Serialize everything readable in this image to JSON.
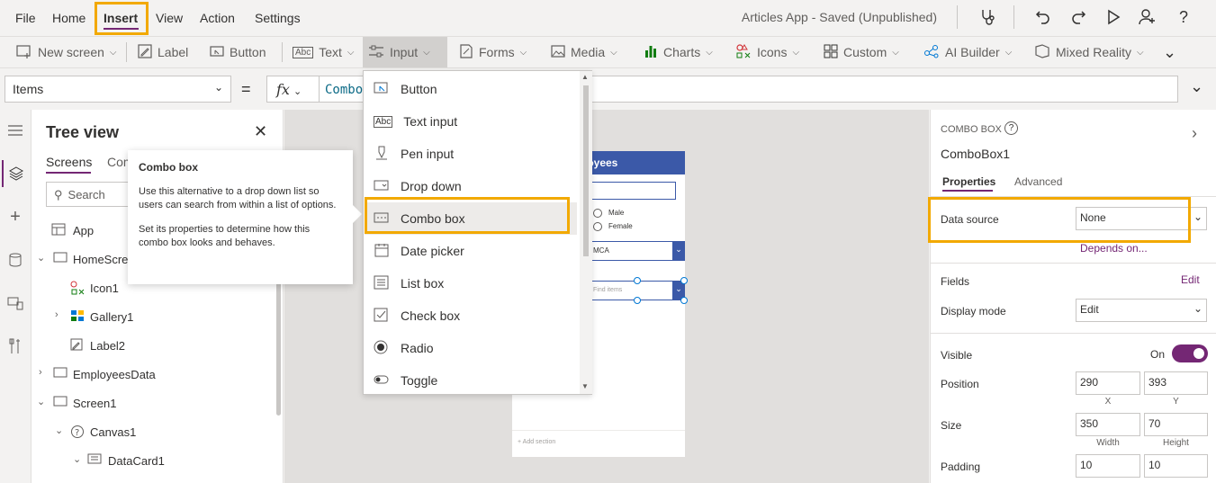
{
  "menubar": {
    "items": [
      "File",
      "Home",
      "Insert",
      "View",
      "Action",
      "Settings"
    ],
    "app_title": "Articles App - Saved (Unpublished)"
  },
  "ribbon": {
    "items": [
      "New screen",
      "Label",
      "Button",
      "Text",
      "Input",
      "Forms",
      "Media",
      "Charts",
      "Icons",
      "Custom",
      "AI Builder",
      "Mixed Reality"
    ]
  },
  "formula": {
    "property": "Items",
    "equals": "=",
    "fx": "fx",
    "value": "Combo"
  },
  "tree": {
    "title": "Tree view",
    "tab_screens": "Screens",
    "tab_components": "Com",
    "search_placeholder": "Search",
    "rows": [
      {
        "label": "App",
        "icon": "app-icon"
      },
      {
        "label": "HomeScree",
        "icon": "screen-icon"
      },
      {
        "label": "Icon1",
        "icon": "icon-icon"
      },
      {
        "label": "Gallery1",
        "icon": "gallery-icon"
      },
      {
        "label": "Label2",
        "icon": "label-icon"
      },
      {
        "label": "EmployeesData",
        "icon": "screen-icon"
      },
      {
        "label": "Screen1",
        "icon": "screen-icon"
      },
      {
        "label": "Canvas1",
        "icon": "canvas-icon"
      },
      {
        "label": "DataCard1",
        "icon": "datacard-icon"
      }
    ]
  },
  "tooltip": {
    "title": "Combo box",
    "p1": "Use this alternative to a drop down list so users can search from within a list of options.",
    "p2": "Set its properties to determine how this combo box looks and behaves."
  },
  "dropdown": {
    "items": [
      "Button",
      "Text input",
      "Pen input",
      "Drop down",
      "Combo box",
      "Date picker",
      "List box",
      "Check box",
      "Radio",
      "Toggle"
    ]
  },
  "phone": {
    "header": "loyees",
    "radio_male": "Male",
    "radio_female": "Female",
    "dropdown_value": "MCA",
    "combo_placeholder": "Find items",
    "add_section": "Add section"
  },
  "properties": {
    "type": "COMBO BOX",
    "name": "ComboBox1",
    "tab_properties": "Properties",
    "tab_advanced": "Advanced",
    "data_source_label": "Data source",
    "data_source_value": "None",
    "depends_on": "Depends on...",
    "fields_label": "Fields",
    "fields_edit": "Edit",
    "display_mode_label": "Display mode",
    "display_mode_value": "Edit",
    "visible_label": "Visible",
    "visible_value": "On",
    "position_label": "Position",
    "position_x": "290",
    "position_y": "393",
    "x_label": "X",
    "y_label": "Y",
    "size_label": "Size",
    "width": "350",
    "height": "70",
    "width_label": "Width",
    "height_label": "Height",
    "padding_label": "Padding",
    "padding_1": "10",
    "padding_2": "10"
  },
  "colors": {
    "accent": "#742774",
    "highlight": "#f2a900",
    "header_blue": "#3b59a8"
  }
}
